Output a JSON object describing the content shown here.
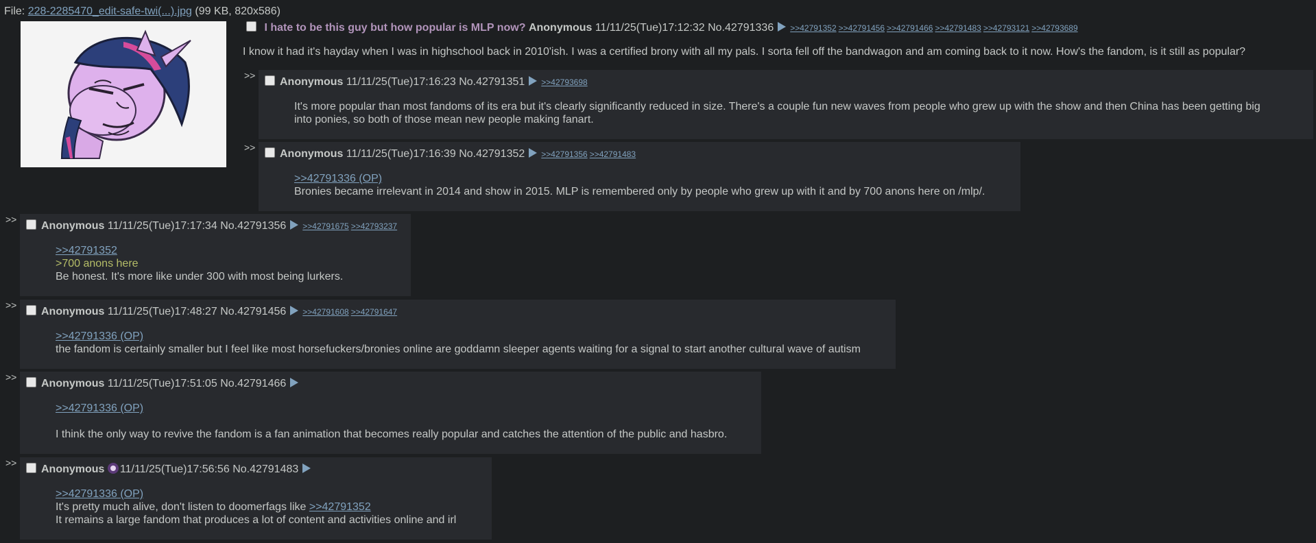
{
  "file": {
    "label": "File:",
    "name": "228-2285470_edit-safe-twi(...).jpg",
    "meta": "(99 KB, 820x586)"
  },
  "op": {
    "subject": "I hate to be this guy but how popular is MLP now?",
    "name": "Anonymous",
    "datetime": "11/11/25(Tue)17:12:32",
    "number": "No.42791336",
    "backlinks": [
      ">>42791352",
      ">>42791456",
      ">>42791466",
      ">>42791483",
      ">>42793121",
      ">>42793689"
    ],
    "text": "I know it had it's hayday when I was in highschool back in 2010'ish. I was a certified brony with all my pals. I sorta fell off the bandwagon and am coming back to it now. How's the fandom, is it still as popular?"
  },
  "side_marker": ">>",
  "replies": [
    {
      "name": "Anonymous",
      "datetime": "11/11/25(Tue)17:16:23",
      "number": "No.42791351",
      "backlinks": [
        ">>42793698"
      ],
      "lines": [
        "It's more popular than most fandoms of its era but it's clearly significantly reduced in size. There's a couple fun new waves from people who grew up with the show and then China has been getting big",
        "into ponies, so both of those mean new people making fanart."
      ]
    },
    {
      "name": "Anonymous",
      "datetime": "11/11/25(Tue)17:16:39",
      "number": "No.42791352",
      "backlinks": [
        ">>42791356",
        ">>42791483"
      ],
      "quotelink": ">>42791336 (OP)",
      "lines": [
        "Bronies became irrelevant in 2014 and show in 2015. MLP is remembered only by people who grew up with it and by 700 anons here on /mlp/."
      ]
    },
    {
      "name": "Anonymous",
      "datetime": "11/11/25(Tue)17:17:34",
      "number": "No.42791356",
      "backlinks": [
        ">>42791675",
        ">>42793237"
      ],
      "quotelink": ">>42791352",
      "greentext": ">700 anons here",
      "lines": [
        "Be honest. It's more like under 300 with most being lurkers."
      ]
    },
    {
      "name": "Anonymous",
      "datetime": "11/11/25(Tue)17:48:27",
      "number": "No.42791456",
      "backlinks": [
        ">>42791608",
        ">>42791647"
      ],
      "quotelink": ">>42791336 (OP)",
      "lines": [
        "the fandom is certainly smaller but I feel like most horsefuckers/bronies online are goddamn sleeper agents waiting for a signal to start another cultural wave of autism"
      ]
    },
    {
      "name": "Anonymous",
      "datetime": "11/11/25(Tue)17:51:05",
      "number": "No.42791466",
      "backlinks": [],
      "quotelink": ">>42791336 (OP)",
      "lines": [
        "I think the only way to revive the fandom is a fan animation that becomes really popular and catches the attention of the public and hasbro."
      ]
    },
    {
      "name": "Anonymous",
      "datetime": "11/11/25(Tue)17:56:56",
      "number": "No.42791483",
      "backlinks": [],
      "quotelink": ">>42791336 (OP)",
      "line1_prefix": "It's pretty much alive, don't listen to doomerfags like ",
      "line1_link": ">>42791352",
      "line2": "It remains a large fandom that produces a lot of content and activities online and irl",
      "flag_icon": "pony-flag-icon"
    }
  ],
  "colors": {
    "background": "#1d1f21",
    "reply_background": "#282a2e",
    "text": "#c5c8c6",
    "link": "#81a2be",
    "subject": "#b294bb",
    "greentext": "#b5bd68"
  }
}
